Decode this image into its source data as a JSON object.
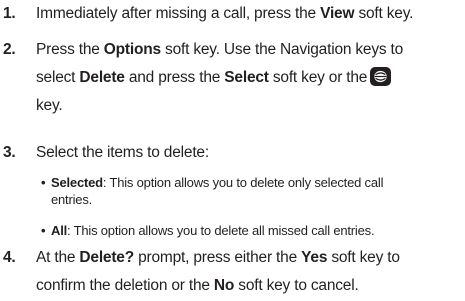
{
  "steps": [
    {
      "number": "1.",
      "line1": {
        "pre": "Immediately after missing a call, press the ",
        "bold": "View",
        "post": " soft key."
      }
    },
    {
      "number": "2.",
      "line1": {
        "pre": "Press the ",
        "bold": "Options",
        "post": " soft key. Use the Navigation keys to"
      },
      "line2": {
        "pre": "select ",
        "bold1": "Delete",
        "mid": " and press the ",
        "bold2": "Select",
        "post": " soft key or the"
      },
      "line3": "key."
    },
    {
      "number": "3.",
      "line1": "Select the items to delete:",
      "bullets": [
        {
          "term": "Selected",
          "line1": ": This option allows you to delete only selected call",
          "line2": "entries."
        },
        {
          "term": "All",
          "line1": ": This option allows you to delete all missed call entries."
        }
      ]
    },
    {
      "number": "4.",
      "line1": {
        "pre": "At the ",
        "bold1": "Delete?",
        "mid": " prompt, press either the ",
        "bold2": "Yes",
        "post": " soft key to"
      },
      "line2": {
        "pre": "confirm the deletion or the ",
        "bold": "No",
        "post": " soft key to cancel."
      }
    }
  ],
  "icons": {
    "ok_key": "ok-key-icon"
  },
  "colors": {
    "text": "#231f20",
    "background": "#ffffff"
  }
}
